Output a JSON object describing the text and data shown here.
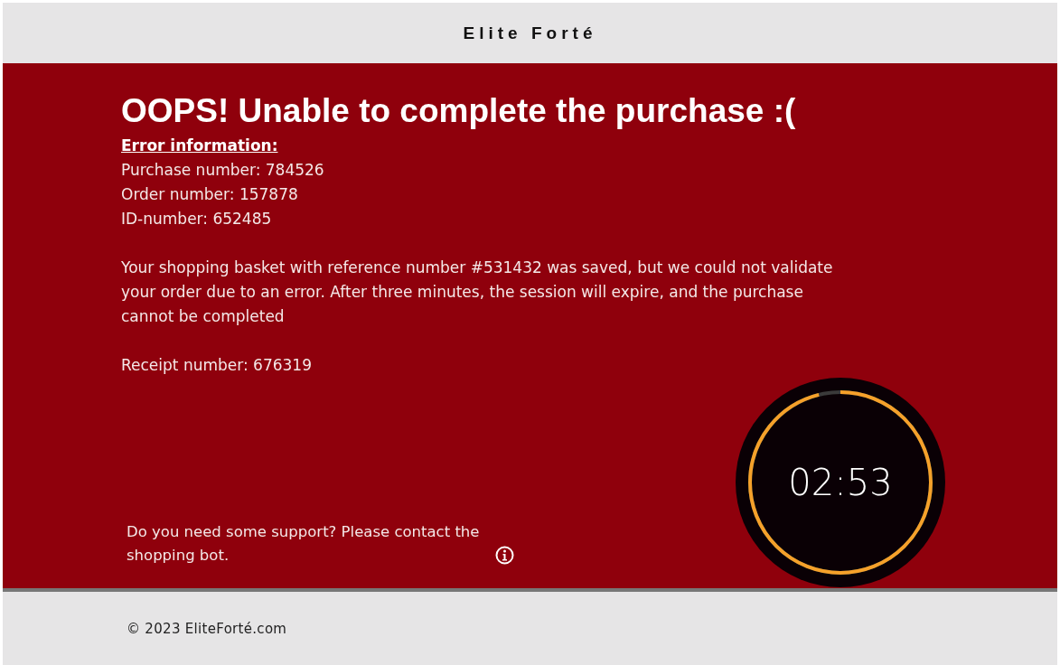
{
  "header": {
    "brand": "Elite Forté"
  },
  "error": {
    "title": "OOPS! Unable to complete the purchase :(",
    "info_heading": "Error information: ",
    "info_lines": [
      "Purchase number: 784526",
      "Order number: 157878",
      "ID-number: 652485"
    ],
    "message": "Your shopping basket with reference number #531432 was saved, but we could not validate your order due to an error. After three minutes, the session will expire, and the purchase cannot be completed",
    "receipt": "Receipt number: 676319"
  },
  "support": {
    "text": "Do you need some support? Please contact the shopping bot."
  },
  "timer": {
    "time": "02:53",
    "level": 0.96
  },
  "footer": {
    "copyright": "© 2023 EliteForté.com"
  }
}
